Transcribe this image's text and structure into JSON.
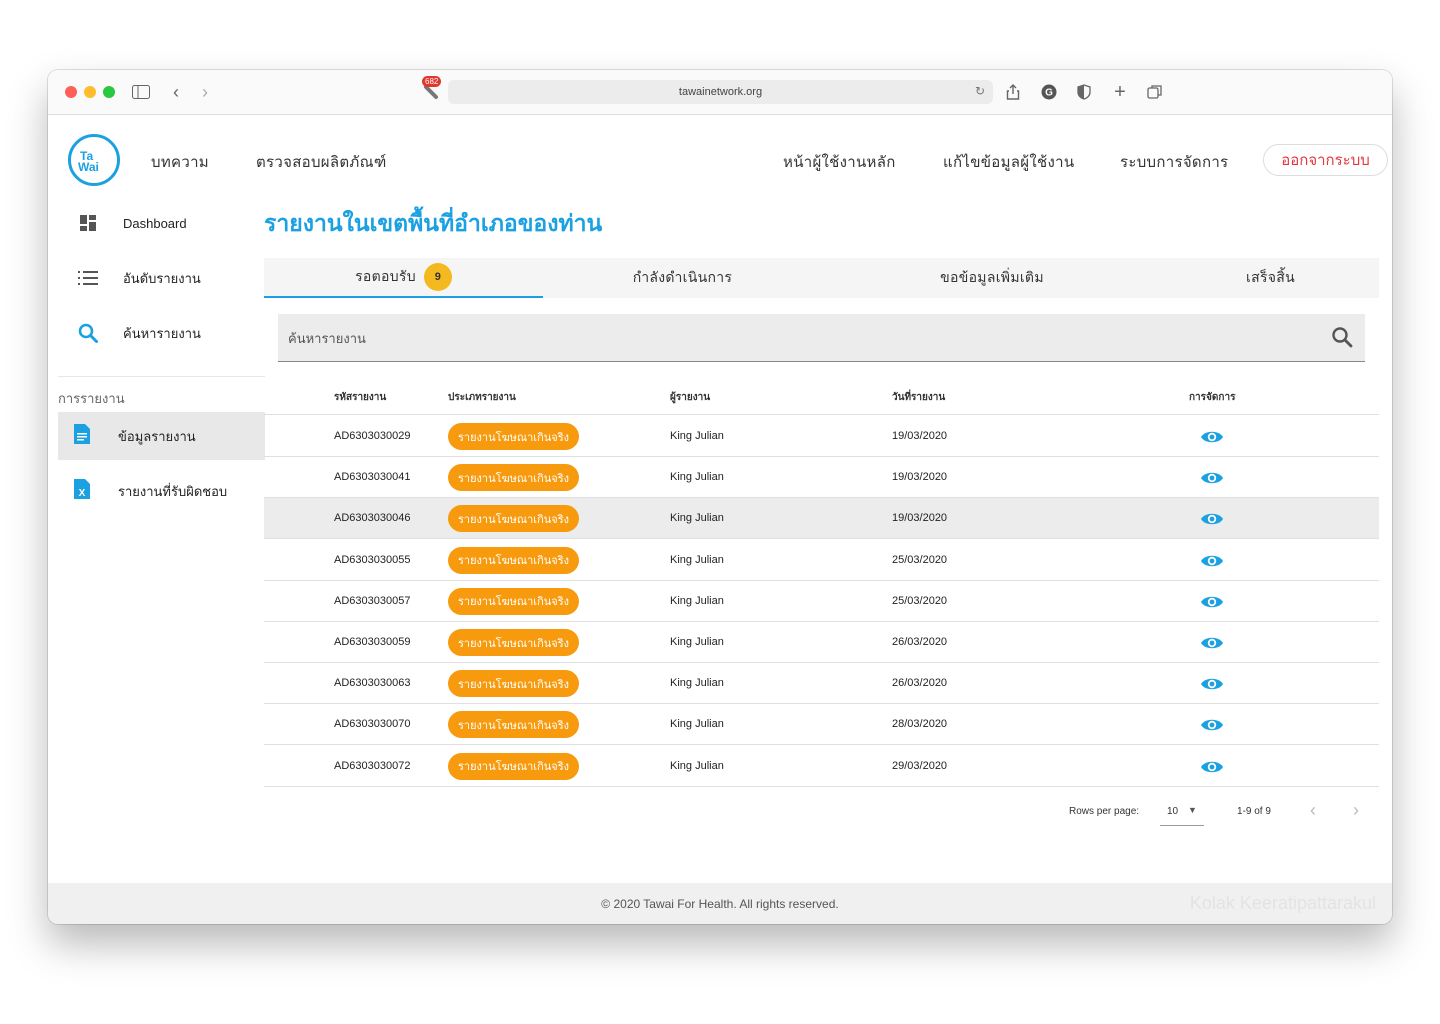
{
  "browser": {
    "url": "tawainetwork.org",
    "extension_badge": "682"
  },
  "logo": {
    "line1": "Ta",
    "line2": "Wai"
  },
  "topnav": {
    "articles": "บทความ",
    "check_products": "ตรวจสอบผลิตภัณฑ์",
    "user_home": "หน้าผู้ใช้งานหลัก",
    "edit_profile": "แก้ไขข้อมูลผู้ใช้งาน",
    "management": "ระบบการจัดการ",
    "logout": "ออกจากระบบ"
  },
  "sidebar": {
    "items": [
      {
        "label": "Dashboard"
      },
      {
        "label": "อันดับรายงาน"
      },
      {
        "label": "ค้นหารายงาน"
      }
    ],
    "section_title": "การรายงาน",
    "sub_items": [
      {
        "label": "ข้อมูลรายงาน"
      },
      {
        "label": "รายงานที่รับผิดชอบ"
      }
    ]
  },
  "main": {
    "title": "รายงานในเขตพื้นที่อำเภอของท่าน",
    "tabs": [
      {
        "label": "รอตอบรับ",
        "badge": "9"
      },
      {
        "label": "กำลังดำเนินการ"
      },
      {
        "label": "ขอข้อมูลเพิ่มเติม"
      },
      {
        "label": "เสร็จสิ้น"
      }
    ],
    "search_placeholder": "ค้นหารายงาน",
    "table": {
      "headers": [
        "รหัสรายงาน",
        "ประเภทรายงาน",
        "ผู้รายงาน",
        "วันที่รายงาน",
        "การจัดการ"
      ],
      "rows": [
        {
          "id": "AD6303030029",
          "type": "รายงานโฆษณาเกินจริง",
          "reporter": "King Julian",
          "date": "19/03/2020"
        },
        {
          "id": "AD6303030041",
          "type": "รายงานโฆษณาเกินจริง",
          "reporter": "King Julian",
          "date": "19/03/2020"
        },
        {
          "id": "AD6303030046",
          "type": "รายงานโฆษณาเกินจริง",
          "reporter": "King Julian",
          "date": "19/03/2020"
        },
        {
          "id": "AD6303030055",
          "type": "รายงานโฆษณาเกินจริง",
          "reporter": "King Julian",
          "date": "25/03/2020"
        },
        {
          "id": "AD6303030057",
          "type": "รายงานโฆษณาเกินจริง",
          "reporter": "King Julian",
          "date": "25/03/2020"
        },
        {
          "id": "AD6303030059",
          "type": "รายงานโฆษณาเกินจริง",
          "reporter": "King Julian",
          "date": "26/03/2020"
        },
        {
          "id": "AD6303030063",
          "type": "รายงานโฆษณาเกินจริง",
          "reporter": "King Julian",
          "date": "26/03/2020"
        },
        {
          "id": "AD6303030070",
          "type": "รายงานโฆษณาเกินจริง",
          "reporter": "King Julian",
          "date": "28/03/2020"
        },
        {
          "id": "AD6303030072",
          "type": "รายงานโฆษณาเกินจริง",
          "reporter": "King Julian",
          "date": "29/03/2020"
        }
      ]
    },
    "pagination": {
      "rows_per_page_label": "Rows per page:",
      "rows_per_page_value": "10",
      "range": "1-9 of 9"
    }
  },
  "footer": {
    "copyright": "© 2020 Tawai For Health. All rights reserved.",
    "watermark": "Kolak Keeratipattarakul"
  },
  "colors": {
    "accent": "#1ba1e2",
    "pill": "#f79a0e",
    "badge": "#f5b920",
    "logout": "#e2383f"
  }
}
